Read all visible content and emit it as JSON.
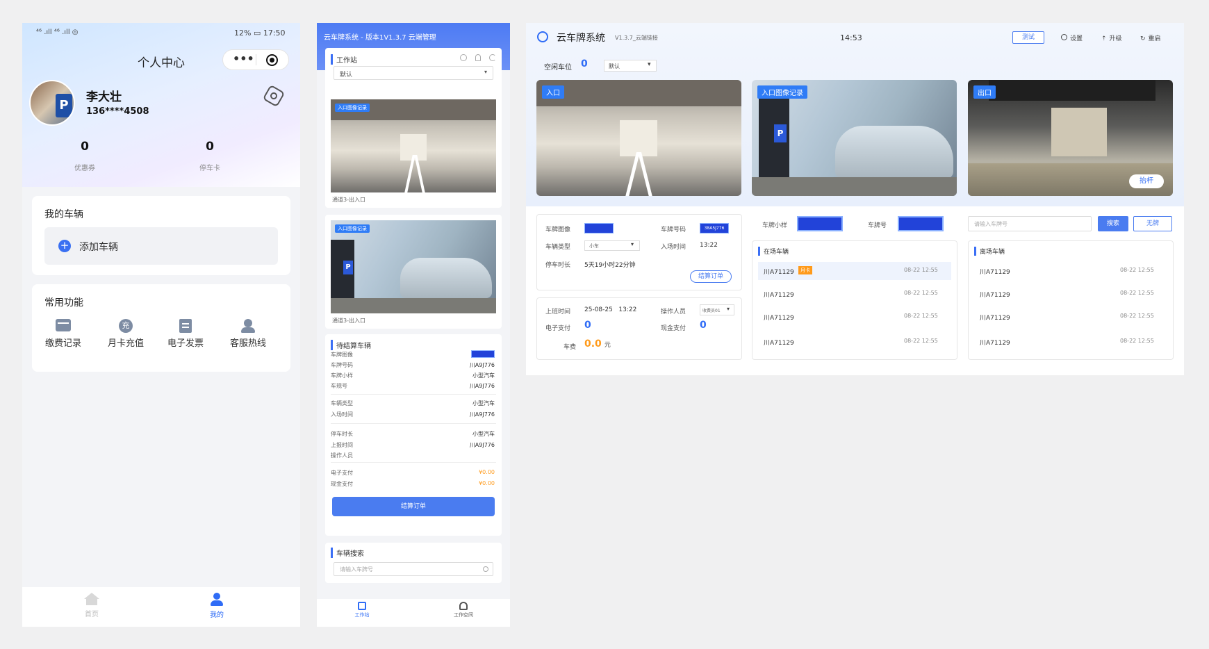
{
  "phone": {
    "status_left": "⁴⁶ .ıll ⁴⁶ .ıll ◎",
    "status_battery": "12%",
    "status_time": "17:50",
    "title": "个人中心",
    "user_name": "李大壮",
    "user_phone": "136****4508",
    "coupons_count": "0",
    "coupons_label": "优惠券",
    "cards_count": "0",
    "cards_label": "停车卡",
    "my_vehicles_title": "我的车辆",
    "add_vehicle_label": "添加车辆",
    "common_functions_title": "常用功能",
    "functions": [
      {
        "label": "缴费记录",
        "icon": "payment-record-icon"
      },
      {
        "label": "月卡充值",
        "icon": "recharge-icon",
        "glyph": "充"
      },
      {
        "label": "电子发票",
        "icon": "invoice-icon"
      },
      {
        "label": "客服热线",
        "icon": "customer-service-icon"
      }
    ],
    "tab_home": "首页",
    "tab_mine": "我的"
  },
  "mobile_work": {
    "header_title": "云车牌系统 - 版本1V1.3.7 云端管理",
    "workstation_title": "工作站",
    "workstation_select": "默认",
    "image1_tag": "入口图像记录",
    "image1_caption": "通道3-出入口",
    "image2_tag": "入口图像记录",
    "image2_caption": "通道3-出入口",
    "pending_title": "待结算车辆",
    "rows": [
      {
        "label": "车牌图像",
        "value": "川A9J776"
      },
      {
        "label": "车牌号码",
        "value": "川A9J776"
      },
      {
        "label": "车牌小样",
        "value": "小型汽车"
      },
      {
        "label": "车规号",
        "value": "川A9J776"
      },
      {
        "label": "车辆类型",
        "value": "小型汽车"
      },
      {
        "label": "入场时间",
        "value": "川A9J776"
      },
      {
        "label": "停车时长",
        "value": "小型汽车"
      },
      {
        "label": "上报时间",
        "value": "川A9J776"
      },
      {
        "label": "操作人员",
        "value": ""
      },
      {
        "label": "电子支付",
        "value": "¥0.00"
      },
      {
        "label": "现金支付",
        "value": "¥0.00"
      }
    ],
    "settle_button": "结算订单",
    "search_title": "车辆搜索",
    "search_placeholder": "请输入车牌号",
    "tab_workstation": "工作站",
    "tab_workspace": "工作空间"
  },
  "desktop": {
    "app_name": "云车牌系统",
    "version": "V1.3.7_云端链接",
    "time": "14:53",
    "test_button": "测试",
    "settings": "设置",
    "upgrade": "升级",
    "restart": "重启",
    "free_spaces_label": "空闲车位",
    "free_spaces_value": "0",
    "default_select": "默认",
    "cam_entry_tag": "入口",
    "cam_record_tag": "入口图像记录",
    "cam_exit_tag": "出口",
    "lift_button": "抬杆",
    "plate_image_label": "车牌图像",
    "plate_number_label": "车牌号码",
    "plate_number_value": "38A5J776",
    "vehicle_type_label": "车辆类型",
    "vehicle_type_value": "小车",
    "entry_time_label": "入场时间",
    "entry_time_value": "13:22",
    "duration_label": "停车时长",
    "duration_value": "5天19小时22分钟",
    "settle_button": "结算订单",
    "shift_time_label": "上班时间",
    "shift_time_value": "25-08-25   13:22",
    "operator_label": "操作人员",
    "operator_value": "收费员01",
    "epay_label": "电子支付",
    "epay_value": "0",
    "cash_label": "现金支付",
    "cash_value": "0",
    "fee_label": "车费",
    "fee_value": "0.0",
    "fee_unit": "元",
    "plate_sample_label": "车牌小样",
    "plate_no_label": "车牌号",
    "in_lot_title": "在场车辆",
    "in_lot": [
      {
        "plate": "川A71129",
        "badge": "月卡",
        "time": "08-22 12:55"
      },
      {
        "plate": "川A71129",
        "badge": "",
        "time": "08-22 12:55"
      },
      {
        "plate": "川A71129",
        "badge": "",
        "time": "08-22 12:55"
      },
      {
        "plate": "川A71129",
        "badge": "",
        "time": "08-22 12:55"
      }
    ],
    "search_placeholder": "请输入车牌号",
    "search_button": "搜索",
    "no_plate_button": "无牌",
    "left_lot_title": "离场车辆",
    "left_lot": [
      {
        "plate": "川A71129",
        "time": "08-22 12:55"
      },
      {
        "plate": "川A71129",
        "time": "08-22 12:55"
      },
      {
        "plate": "川A71129",
        "time": "08-22 12:55"
      },
      {
        "plate": "川A71129",
        "time": "08-22 12:55"
      }
    ]
  }
}
